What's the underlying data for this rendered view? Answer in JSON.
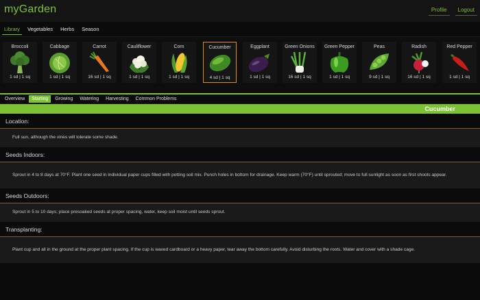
{
  "app": {
    "title": "myGarden",
    "links": [
      "Profile",
      "Logout"
    ]
  },
  "mainnav": [
    "Library",
    "Vegetables",
    "Herbs",
    "Season"
  ],
  "plants": [
    {
      "name": "Broccoli",
      "stats": "1 sd | 1 sq",
      "icon": "broccoli-icon"
    },
    {
      "name": "Cabbage",
      "stats": "1 sd | 1 sq",
      "icon": "cabbage-icon"
    },
    {
      "name": "Carrot",
      "stats": "16 sd | 1 sq",
      "icon": "carrot-icon"
    },
    {
      "name": "Cauliflower",
      "stats": "1 sd | 1 sq",
      "icon": "cauliflower-icon"
    },
    {
      "name": "Corn",
      "stats": "1 sd | 1 sq",
      "icon": "corn-icon"
    },
    {
      "name": "Cucumber",
      "stats": "4 sd | 1 sq",
      "icon": "cucumber-icon"
    },
    {
      "name": "Eggplant",
      "stats": "1 sd | 1 sq",
      "icon": "eggplant-icon"
    },
    {
      "name": "Green Onions",
      "stats": "16 sd | 1 sq",
      "icon": "green-onion-icon"
    },
    {
      "name": "Green Pepper",
      "stats": "1 sd | 1 sq",
      "icon": "green-pepper-icon"
    },
    {
      "name": "Peas",
      "stats": "9 sd | 1 sq",
      "icon": "peas-icon"
    },
    {
      "name": "Radish",
      "stats": "16 sd | 1 sq",
      "icon": "radish-icon"
    },
    {
      "name": "Red Pepper",
      "stats": "1 sd | 1 sq",
      "icon": "red-pepper-icon"
    }
  ],
  "subtabs": [
    "Overview",
    "Starting",
    "Growing",
    "Watering",
    "Harvesting",
    "Common Problems"
  ],
  "selected_plant": "Cucumber",
  "sections": [
    {
      "heading": "Location:",
      "body": "Full sun, although the vines will tolerate some shade."
    },
    {
      "heading": "Seeds Indoors:",
      "body": "Sprout in 4 to 8 days at 70°F. Plant one seed in individual paper cups filled with potting soil mix. Punch holes in bottom for drainage. Keep warm (70°F) until sprouted; move to full sunlight as soon as first shoots appear."
    },
    {
      "heading": "Seeds Outdoors:",
      "body": "Sprout in 5 to 10 days; place presoaked seeds at proper spacing, water, keep soil moist until seeds sprout."
    },
    {
      "heading": "Transplanting:",
      "body": "Plant cup and all in the ground at the proper plant spacing. If the cup is waxed cardboard or a heavy paper, tear away the bottom carefully. Avoid disturbing the roots. Water and cover with a shade cage."
    }
  ],
  "colors": {
    "accent": "#7cc234",
    "selected_border": "#e08a2c",
    "background": "#0b0b0b"
  }
}
